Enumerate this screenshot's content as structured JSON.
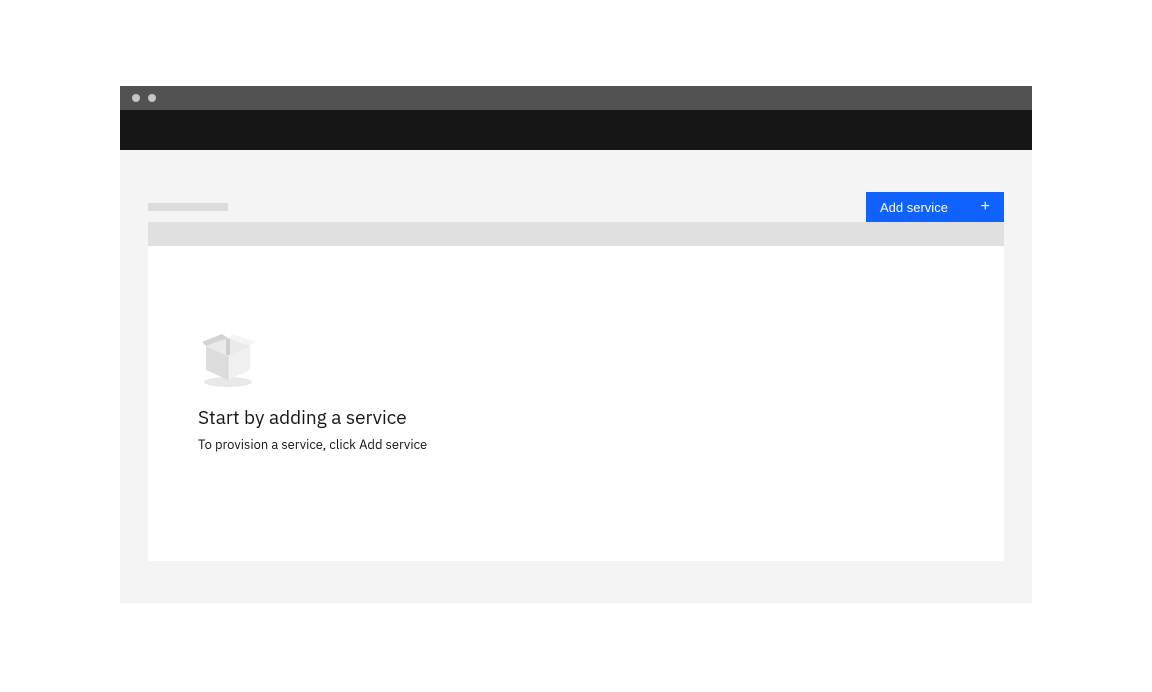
{
  "toolbar": {
    "add_service_label": "Add service"
  },
  "empty_state": {
    "title": "Start by adding a service",
    "subtitle": "To provision a service, click Add service"
  },
  "colors": {
    "primary_button": "#0f62fe",
    "header": "#161616",
    "chrome": "#525252",
    "page_bg": "#f4f4f4",
    "bar": "#e0e0e0"
  }
}
